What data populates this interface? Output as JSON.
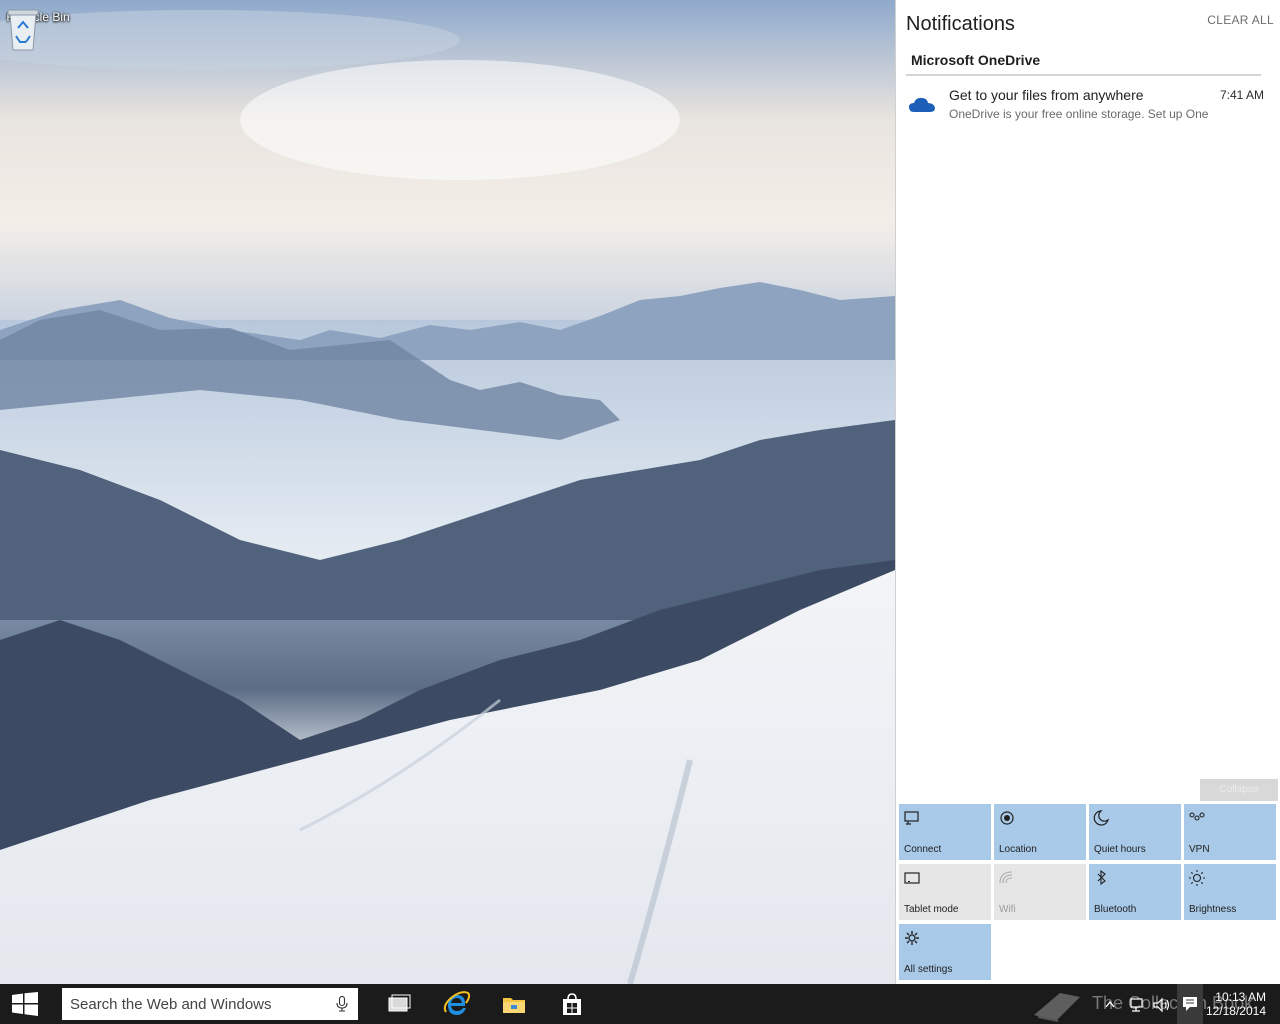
{
  "desktop": {
    "recycle_bin_label": "Recycle Bin"
  },
  "action_center": {
    "title": "Notifications",
    "clear_all": "CLEAR ALL",
    "group_header": "Microsoft OneDrive",
    "notification": {
      "heading": "Get to your files from anywhere",
      "body": "OneDrive is your free online storage. Set up OneDrive",
      "time": "7:41 AM",
      "icon": "onedrive-cloud-icon"
    },
    "collapse_label": "Collapse",
    "quick_actions": [
      {
        "label": "Connect",
        "icon": "connect-icon",
        "state": "on"
      },
      {
        "label": "Location",
        "icon": "location-icon",
        "state": "on"
      },
      {
        "label": "Quiet hours",
        "icon": "moon-icon",
        "state": "on"
      },
      {
        "label": "VPN",
        "icon": "vpn-icon",
        "state": "on"
      },
      {
        "label": "Tablet mode",
        "icon": "tablet-icon",
        "state": "off"
      },
      {
        "label": "Wifi",
        "icon": "wifi-icon",
        "state": "disabled"
      },
      {
        "label": "Bluetooth",
        "icon": "bluetooth-icon",
        "state": "on"
      },
      {
        "label": "Brightness",
        "icon": "brightness-icon",
        "state": "on"
      },
      {
        "label": "All settings",
        "icon": "gear-icon",
        "state": "on"
      }
    ],
    "colors": {
      "tile_on": "#a8c9e8",
      "tile_off": "#e6e6e6"
    }
  },
  "taskbar": {
    "search_placeholder": "Search the Web and Windows",
    "clock_time": "10:13 AM",
    "clock_date": "12/18/2014",
    "watermark": "The Collection Book",
    "pinned": [
      "task-view-icon",
      "internet-explorer-icon",
      "file-explorer-icon",
      "store-icon"
    ]
  }
}
